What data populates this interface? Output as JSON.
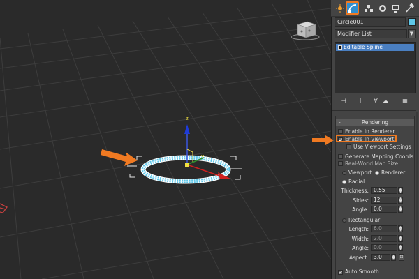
{
  "command_panel": {
    "tabs": [
      {
        "name": "create-tab",
        "icon": "sun-icon"
      },
      {
        "name": "modify-tab",
        "icon": "modify-icon",
        "active": true
      },
      {
        "name": "hierarchy-tab",
        "icon": "hierarchy-icon"
      },
      {
        "name": "motion-tab",
        "icon": "motion-icon"
      },
      {
        "name": "display-tab",
        "icon": "display-icon"
      },
      {
        "name": "utilities-tab",
        "icon": "hammer-icon"
      }
    ],
    "object_name": "Circle001",
    "object_color": "#5fc7e8",
    "modifier_list_label": "Modifier List",
    "modifier_stack": [
      "Editable Spline"
    ]
  },
  "rendering": {
    "title": "Rendering",
    "enable_in_renderer": "Enable In Renderer",
    "enable_in_viewport": "Enable In Viewport",
    "use_viewport_settings": "Use Viewport Settings",
    "generate_mapping": "Generate Mapping Coords.",
    "real_world_map_size": "Real-World Map Size",
    "viewport_label": "Viewport",
    "renderer_label": "Renderer",
    "radial_label": "Radial",
    "thickness_label": "Thickness:",
    "thickness_value": "0.55",
    "sides_label": "Sides:",
    "sides_value": "12",
    "angle_label": "Angle:",
    "angle_value": "0.0",
    "rectangular_label": "Rectangular",
    "length_label": "Length:",
    "length_value": "6.0",
    "width_label": "Width:",
    "width_value": "2.0",
    "rect_angle_label": "Angle:",
    "rect_angle_value": "0.0",
    "aspect_label": "Aspect:",
    "aspect_value": "3.0",
    "auto_smooth_label": "Auto Smooth"
  },
  "colors": {
    "highlight": "#f07a22",
    "selection": "#4a7fc1",
    "accent_blue": "#2f8fd0"
  }
}
